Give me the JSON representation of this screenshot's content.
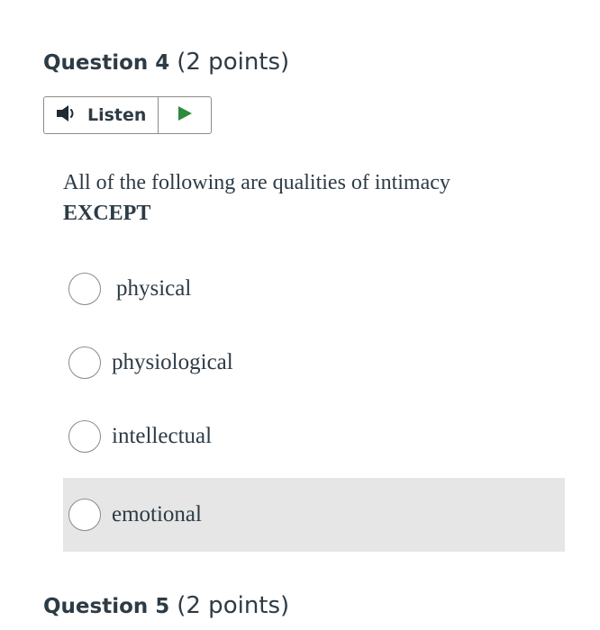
{
  "question4": {
    "title": "Question 4",
    "points": "(2 points)",
    "listen_label": "Listen",
    "text_line1": "All of the following are qualities of intimacy",
    "text_line2": "EXCEPT",
    "options": [
      {
        "label": "physical"
      },
      {
        "label": "physiological"
      },
      {
        "label": "intellectual"
      },
      {
        "label": "emotional"
      }
    ]
  },
  "question5": {
    "title": "Question 5",
    "points": "(2 points)"
  },
  "icons": {
    "speaker": "speaker-icon",
    "play": "play-icon"
  },
  "colors": {
    "text": "#2d3b45",
    "play": "#2e8b3a",
    "hover_bg": "#e6e6e6",
    "border": "#8b8b8b"
  }
}
